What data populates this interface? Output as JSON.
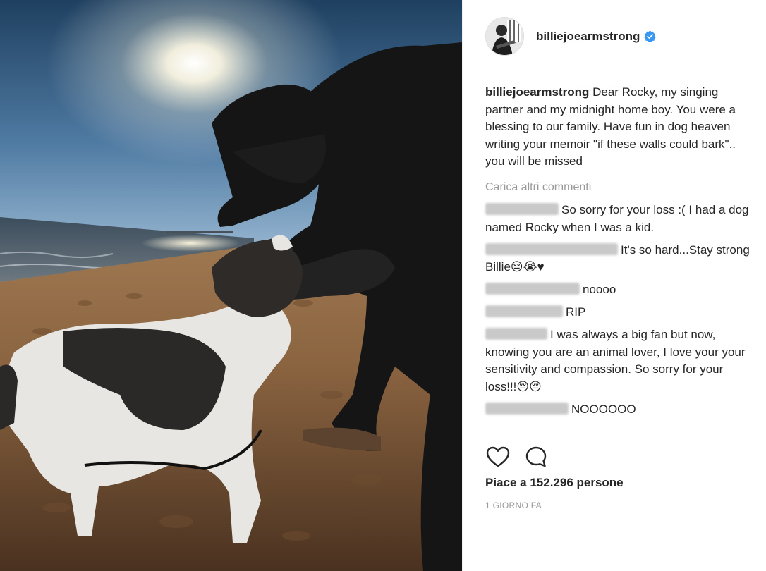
{
  "post": {
    "username": "billiejoearmstrong",
    "verified": true,
    "photo_alt": "",
    "caption": {
      "username": "billiejoearmstrong",
      "text": "Dear Rocky, my singing partner and my midnight home boy. You were a blessing to our family. Have fun in dog heaven writing your memoir \"if these walls could bark\".. you will be missed"
    },
    "load_more_label": "Carica altri commenti",
    "comments": [
      {
        "text": "So sorry for your loss :( I had a dog named Rocky when I was a kid."
      },
      {
        "text": "It's so hard...Stay strong Billie😔😭♥"
      },
      {
        "text": "noooo"
      },
      {
        "text": "RIP"
      },
      {
        "text": "I was always a big fan but now, knowing you are an animal lover, I love your your sensitivity and compassion. So sorry for your loss!!!😔😔"
      },
      {
        "text": "NOOOOOO"
      }
    ],
    "likes_label": "Piace a 152.296 persone",
    "timestamp": "1 GIORNO FA"
  },
  "icons": {
    "like": "heart-outline-icon",
    "comment": "speech-bubble-icon",
    "verified": "verified-badge-icon"
  },
  "colors": {
    "verified_blue": "#3897f0",
    "muted_text": "#999999",
    "text": "#262626"
  }
}
